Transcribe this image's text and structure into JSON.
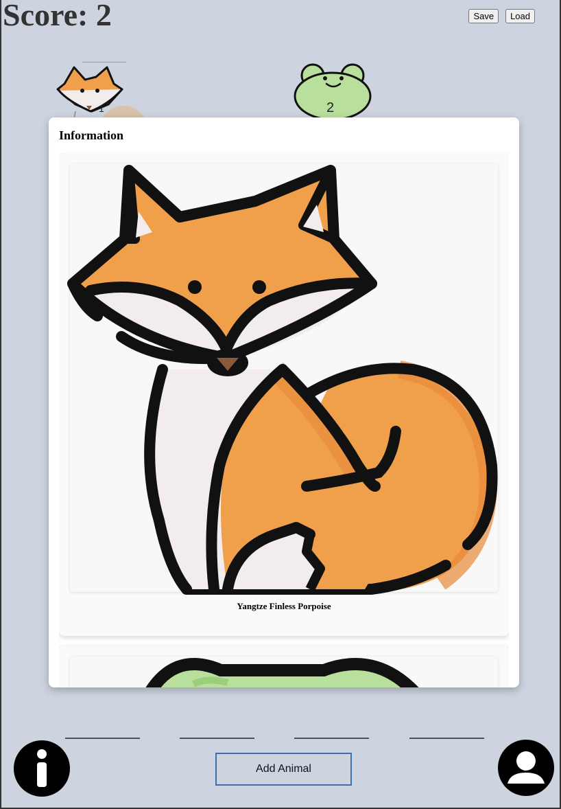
{
  "header": {
    "score_label": "Score: 2",
    "save_label": "Save",
    "load_label": "Load"
  },
  "board": {
    "fox_number": "1",
    "frog_number": "2"
  },
  "modal": {
    "title": "Information",
    "cards": [
      {
        "caption": "Yangtze Finless Porpoise",
        "icon": "fox-icon"
      },
      {
        "caption": "",
        "icon": "frog-icon"
      }
    ]
  },
  "footer": {
    "add_animal_label": "Add Animal",
    "info_icon": "info-icon",
    "user_icon": "user-icon"
  },
  "colors": {
    "background": "#cdd4e0",
    "fox_orange": "#f0a04b",
    "fox_dark_orange": "#e8893a",
    "fox_white": "#f2ecec",
    "frog_green": "#b9df9c",
    "button_border": "#3d6fb0"
  }
}
